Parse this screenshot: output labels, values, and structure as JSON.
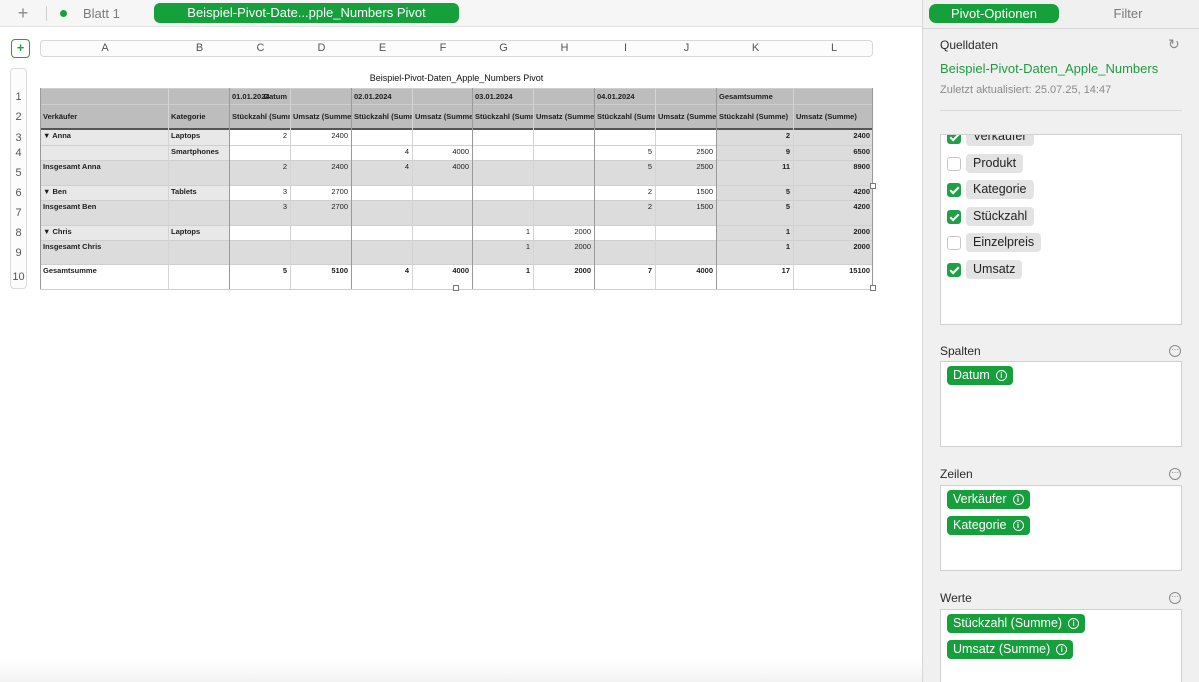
{
  "tabbar": {
    "add_icon": "plus-icon",
    "sheet_label": "Blatt 1",
    "active_table_tab": "Beispiel-Pivot-Date...pple_Numbers Pivot"
  },
  "sheet": {
    "column_letters": [
      "A",
      "B",
      "C",
      "D",
      "E",
      "F",
      "G",
      "H",
      "I",
      "J",
      "K",
      "L"
    ],
    "row_numbers": [
      "1",
      "2",
      "3",
      "4",
      "5",
      "6",
      "7",
      "8",
      "9",
      "10"
    ],
    "table_title": "Beispiel-Pivot-Daten_Apple_Numbers Pivot",
    "header_row1": {
      "datum_label": "Datum",
      "dates": [
        "01.01.2024",
        "02.01.2024",
        "03.01.2024",
        "04.01.2024"
      ],
      "grand_total": "Gesamtsumme"
    },
    "header_row2": {
      "verkaeufer": "Verkäufer",
      "kategorie": "Kategorie",
      "measures": [
        "Stückzahl (Summe)",
        "Umsatz (Summe)",
        "Stückzahl (Summe)",
        "Umsatz (Summe)",
        "Stückzahl (Summe)",
        "Umsatz (Summe)",
        "Stückzahl (Summe)",
        "Umsatz (Summe)",
        "Stückzahl (Summe)",
        "Umsatz (Summe)"
      ]
    },
    "rows": [
      {
        "a": "▼ Anna",
        "b": "Laptops",
        "vals": [
          "2",
          "2400",
          "",
          "",
          "",
          "",
          "",
          "",
          "2",
          "2400"
        ]
      },
      {
        "a": "",
        "b": "Smartphones",
        "vals": [
          "",
          "",
          "4",
          "4000",
          "",
          "",
          "5",
          "2500",
          "9",
          "6500"
        ]
      },
      {
        "a": "Insgesamt Anna",
        "b": "",
        "vals": [
          "2",
          "2400",
          "4",
          "4000",
          "",
          "",
          "5",
          "2500",
          "11",
          "8900"
        ]
      },
      {
        "a": "▼ Ben",
        "b": "Tablets",
        "vals": [
          "3",
          "2700",
          "",
          "",
          "",
          "",
          "2",
          "1500",
          "5",
          "4200"
        ]
      },
      {
        "a": "Insgesamt Ben",
        "b": "",
        "vals": [
          "3",
          "2700",
          "",
          "",
          "",
          "",
          "2",
          "1500",
          "5",
          "4200"
        ]
      },
      {
        "a": "▼ Chris",
        "b": "Laptops",
        "vals": [
          "",
          "",
          "",
          "",
          "1",
          "2000",
          "",
          "",
          "1",
          "2000"
        ]
      },
      {
        "a": "Insgesamt Chris",
        "b": "",
        "vals": [
          "",
          "",
          "",
          "",
          "1",
          "2000",
          "",
          "",
          "1",
          "2000"
        ]
      },
      {
        "a": "Gesamtsumme",
        "b": "",
        "vals": [
          "5",
          "5100",
          "4",
          "4000",
          "1",
          "2000",
          "7",
          "4000",
          "17",
          "15100"
        ]
      }
    ]
  },
  "inspector": {
    "tab_pivot_options": "Pivot-Optionen",
    "tab_filter": "Filter",
    "source_title": "Quelldaten",
    "source_name": "Beispiel-Pivot-Daten_Apple_Numbers",
    "updated": "Zuletzt aktualisiert: 25.07.25, 14:47",
    "fields": [
      {
        "label": "Verkäufer",
        "checked": true
      },
      {
        "label": "Produkt",
        "checked": false
      },
      {
        "label": "Kategorie",
        "checked": true
      },
      {
        "label": "Stückzahl",
        "checked": true
      },
      {
        "label": "Einzelpreis",
        "checked": false
      },
      {
        "label": "Umsatz",
        "checked": true
      }
    ],
    "columns_title": "Spalten",
    "columns": [
      "Datum"
    ],
    "rows_title": "Zeilen",
    "rows": [
      "Verkäufer",
      "Kategorie"
    ],
    "values_title": "Werte",
    "values": [
      "Stückzahl (Summe)",
      "Umsatz (Summe)"
    ]
  },
  "colors": {
    "accent_green": "#16a03c",
    "header_gray": "#bdbdbd",
    "subtotal_gray": "#dcdcdc"
  }
}
